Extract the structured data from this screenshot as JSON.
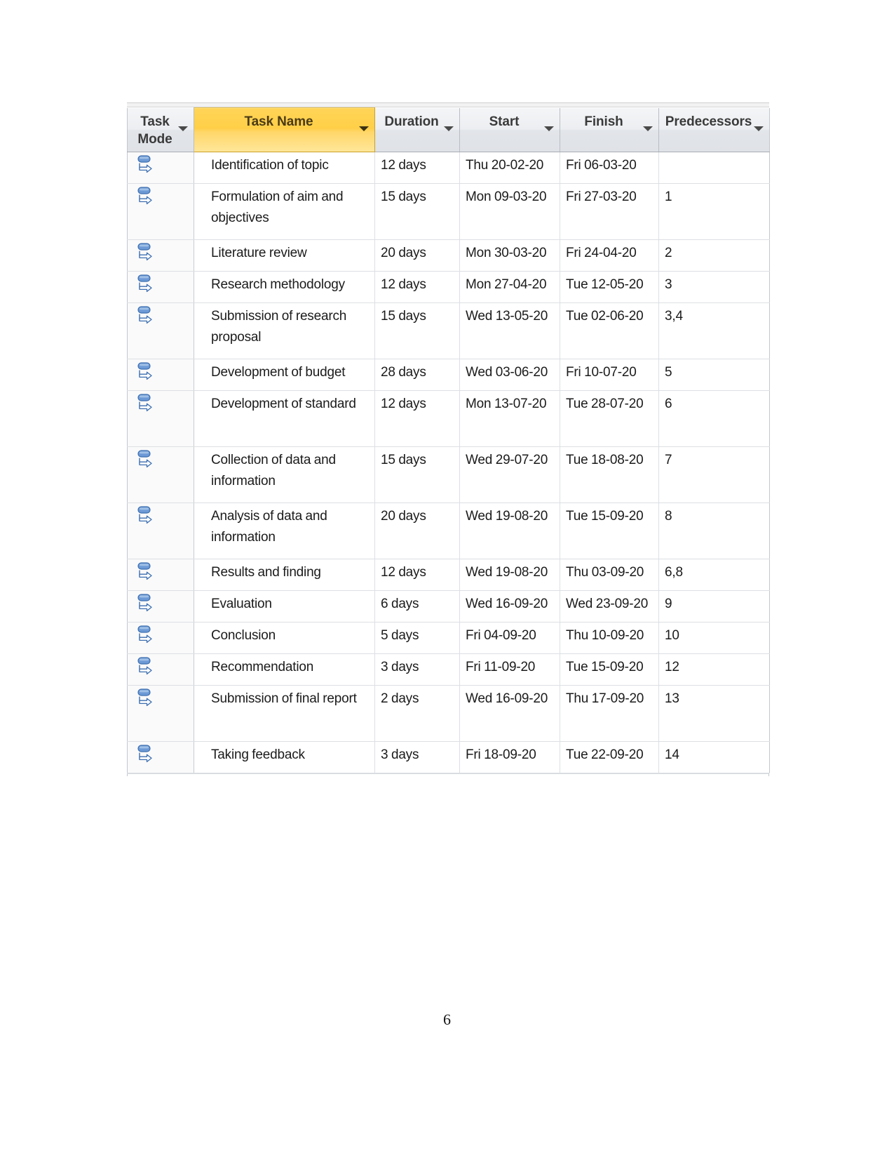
{
  "document": {
    "page_number": "6"
  },
  "grid": {
    "columns": [
      {
        "key": "task_mode",
        "label": "Task\nMode",
        "highlight": false,
        "caret": "chevron-down-icon"
      },
      {
        "key": "task_name",
        "label": "Task Name",
        "highlight": true,
        "caret": "chevron-down-icon"
      },
      {
        "key": "duration",
        "label": "Duration",
        "highlight": false,
        "caret": "chevron-down-icon"
      },
      {
        "key": "start",
        "label": "Start",
        "highlight": false,
        "caret": "chevron-down-icon"
      },
      {
        "key": "finish",
        "label": "Finish",
        "highlight": false,
        "caret": "chevron-down-icon"
      },
      {
        "key": "predecessors",
        "label": "Predecessors",
        "highlight": false,
        "caret": "chevron-down-icon"
      }
    ],
    "mode_icon": "manually-scheduled-task-icon",
    "rows": [
      {
        "mode": "manually-scheduled-task-icon",
        "name": "Identification of topic",
        "duration": "12 days",
        "start": "Thu 20-02-20",
        "finish": "Fri 06-03-20",
        "predecessors": "",
        "tall": false
      },
      {
        "mode": "manually-scheduled-task-icon",
        "name": "Formulation of aim and objectives",
        "duration": "15 days",
        "start": "Mon 09-03-20",
        "finish": "Fri 27-03-20",
        "predecessors": "1",
        "tall": true
      },
      {
        "mode": "manually-scheduled-task-icon",
        "name": "Literature review",
        "duration": "20 days",
        "start": "Mon 30-03-20",
        "finish": "Fri 24-04-20",
        "predecessors": "2",
        "tall": false
      },
      {
        "mode": "manually-scheduled-task-icon",
        "name": "Research methodology",
        "duration": "12 days",
        "start": "Mon 27-04-20",
        "finish": "Tue 12-05-20",
        "predecessors": "3",
        "tall": false
      },
      {
        "mode": "manually-scheduled-task-icon",
        "name": "Submission of research proposal",
        "duration": "15 days",
        "start": "Wed 13-05-20",
        "finish": "Tue 02-06-20",
        "predecessors": "3,4",
        "tall": true
      },
      {
        "mode": "manually-scheduled-task-icon",
        "name": "Development of budget",
        "duration": "28 days",
        "start": "Wed 03-06-20",
        "finish": "Fri 10-07-20",
        "predecessors": "5",
        "tall": false
      },
      {
        "mode": "manually-scheduled-task-icon",
        "name": "Development of standard",
        "duration": "12 days",
        "start": "Mon 13-07-20",
        "finish": "Tue 28-07-20",
        "predecessors": "6",
        "tall": true
      },
      {
        "mode": "manually-scheduled-task-icon",
        "name": "Collection of data and information",
        "duration": "15 days",
        "start": "Wed 29-07-20",
        "finish": "Tue 18-08-20",
        "predecessors": "7",
        "tall": true
      },
      {
        "mode": "manually-scheduled-task-icon",
        "name": "Analysis of data and information",
        "duration": "20 days",
        "start": "Wed 19-08-20",
        "finish": "Tue 15-09-20",
        "predecessors": "8",
        "tall": true
      },
      {
        "mode": "manually-scheduled-task-icon",
        "name": "Results and finding",
        "duration": "12 days",
        "start": "Wed 19-08-20",
        "finish": "Thu 03-09-20",
        "predecessors": "6,8",
        "tall": false
      },
      {
        "mode": "manually-scheduled-task-icon",
        "name": "Evaluation",
        "duration": "6 days",
        "start": "Wed 16-09-20",
        "finish": "Wed 23-09-20",
        "predecessors": "9",
        "tall": false
      },
      {
        "mode": "manually-scheduled-task-icon",
        "name": "Conclusion",
        "duration": "5 days",
        "start": "Fri 04-09-20",
        "finish": "Thu 10-09-20",
        "predecessors": "10",
        "tall": false
      },
      {
        "mode": "manually-scheduled-task-icon",
        "name": "Recommendation",
        "duration": "3 days",
        "start": "Fri 11-09-20",
        "finish": "Tue 15-09-20",
        "predecessors": "12",
        "tall": false
      },
      {
        "mode": "manually-scheduled-task-icon",
        "name": "Submission of final report",
        "duration": "2 days",
        "start": "Wed 16-09-20",
        "finish": "Thu 17-09-20",
        "predecessors": "13",
        "tall": true
      },
      {
        "mode": "manually-scheduled-task-icon",
        "name": "Taking feedback",
        "duration": "3 days",
        "start": "Fri 18-09-20",
        "finish": "Tue 22-09-20",
        "predecessors": "14",
        "tall": false
      }
    ]
  },
  "colors": {
    "header_highlight": "#ffd457",
    "header_default": "#e6e9ed",
    "mode_icon_blue": "#5b8fd0",
    "grid_line": "#dcdfe3"
  }
}
